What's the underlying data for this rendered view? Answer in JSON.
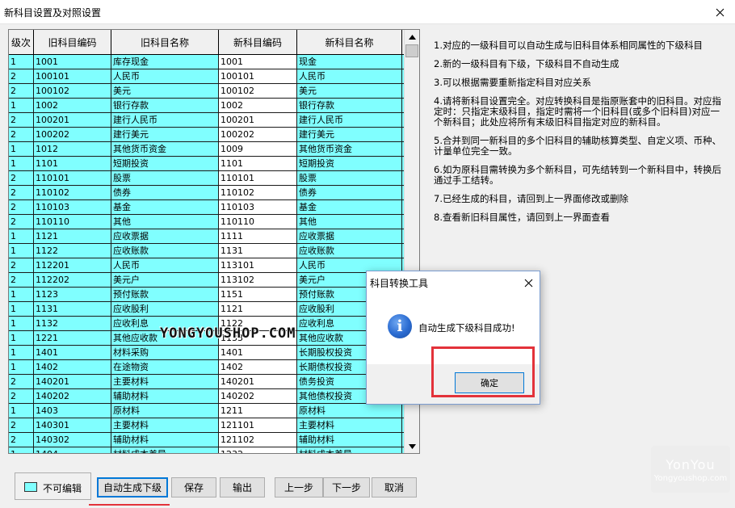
{
  "window": {
    "title": "新科目设置及对照设置"
  },
  "grid": {
    "columns": [
      "级次",
      "旧科目编码",
      "旧科目名称",
      "新科目编码",
      "新科目名称",
      "新"
    ],
    "rows": [
      [
        "1",
        "1001",
        "库存现金",
        "1001",
        "现金"
      ],
      [
        "2",
        "100101",
        "人民币",
        "100101",
        "人民币"
      ],
      [
        "2",
        "100102",
        "美元",
        "100102",
        "美元"
      ],
      [
        "1",
        "1002",
        "银行存款",
        "1002",
        "银行存款"
      ],
      [
        "2",
        "100201",
        "建行人民币",
        "100201",
        "建行人民币"
      ],
      [
        "2",
        "100202",
        "建行美元",
        "100202",
        "建行美元"
      ],
      [
        "1",
        "1012",
        "其他货币资金",
        "1009",
        "其他货币资金"
      ],
      [
        "1",
        "1101",
        "短期投资",
        "1101",
        "短期投资"
      ],
      [
        "2",
        "110101",
        "股票",
        "110101",
        "股票"
      ],
      [
        "2",
        "110102",
        "债券",
        "110102",
        "债券"
      ],
      [
        "2",
        "110103",
        "基金",
        "110103",
        "基金"
      ],
      [
        "2",
        "110110",
        "其他",
        "110110",
        "其他"
      ],
      [
        "1",
        "1121",
        "应收票据",
        "1111",
        "应收票据"
      ],
      [
        "1",
        "1122",
        "应收账款",
        "1131",
        "应收账款"
      ],
      [
        "2",
        "112201",
        "人民币",
        "113101",
        "人民币"
      ],
      [
        "2",
        "112202",
        "美元户",
        "113102",
        "美元户"
      ],
      [
        "1",
        "1123",
        "预付账款",
        "1151",
        "预付账款"
      ],
      [
        "1",
        "1131",
        "应收股利",
        "1121",
        "应收股利"
      ],
      [
        "1",
        "1132",
        "应收利息",
        "1122",
        "应收利息"
      ],
      [
        "1",
        "1221",
        "其他应收款",
        "1133",
        "其他应收款"
      ],
      [
        "1",
        "1401",
        "材料采购",
        "1401",
        "长期股权投资"
      ],
      [
        "1",
        "1402",
        "在途物资",
        "1402",
        "长期债权投资"
      ],
      [
        "2",
        "140201",
        "主要材料",
        "140201",
        "债务投资"
      ],
      [
        "2",
        "140202",
        "辅助材料",
        "140202",
        "其他债权投资"
      ],
      [
        "1",
        "1403",
        "原材料",
        "1211",
        "原材料"
      ],
      [
        "2",
        "140301",
        "主要材料",
        "121101",
        "主要材料"
      ],
      [
        "2",
        "140302",
        "辅助材料",
        "121102",
        "辅助材料"
      ],
      [
        "1",
        "1404",
        "材料成本差异",
        "1232",
        "材料成本差异"
      ]
    ]
  },
  "notes": [
    "1.对应的一级科目可以自动生成与旧科目体系相同属性的下级科目",
    "2.新的一级科目有下级，下级科目不自动生成",
    "3.可以根据需要重新指定科目对应关系",
    "4.请将新科目设置完全。对应转换科目是指原账套中的旧科目。对应指定时：只指定末级科目，指定时需将一个旧科目(或多个旧科目)对应一个新科目；此处应将所有末级旧科目指定对应的新科目。",
    "5.合并到同一新科目的多个旧科目的辅助核算类型、自定义项、币种、计量单位完全一致。",
    "6.如为原科目需转换为多个新科目，可先结转到一个新科目中，转换后通过手工结转。",
    "7.已经生成的科目，请回到上一界面修改或删除",
    "8.查看新旧科目属性，请回到上一界面查看"
  ],
  "legend": {
    "label": "不可编辑",
    "color": "#80ffff"
  },
  "buttons": {
    "auto_generate": "自动生成下级",
    "save": "保存",
    "export": "输出",
    "prev": "上一步",
    "next": "下一步",
    "cancel": "取消"
  },
  "dialog": {
    "title": "科目转换工具",
    "message": "自动生成下级科目成功!",
    "ok": "确定",
    "icon": "info-icon"
  },
  "watermark": {
    "text": "YONGYOUSHOP.COM",
    "corner_big": "YonYou",
    "corner_small": "Yongyoushop.com"
  },
  "colors": {
    "readonly": "#80ffff",
    "highlight": "#e3323a",
    "accent": "#0078d7"
  }
}
